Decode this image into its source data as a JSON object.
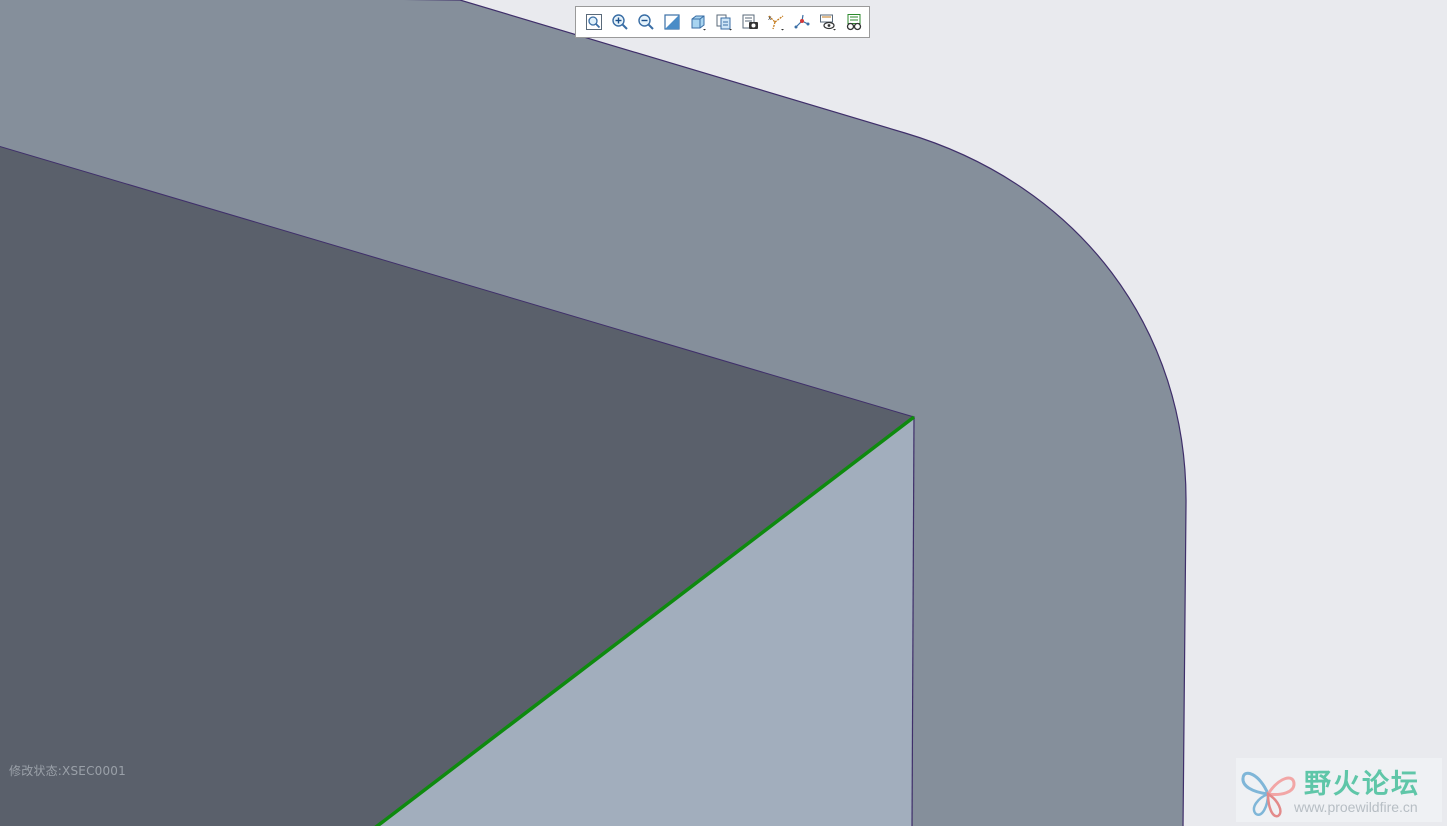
{
  "toolbar": {
    "items": [
      {
        "icon": "refit-icon"
      },
      {
        "icon": "zoom-in-icon"
      },
      {
        "icon": "zoom-out-icon"
      },
      {
        "icon": "repaint-icon"
      },
      {
        "icon": "display-style-icon"
      },
      {
        "icon": "saved-views-icon"
      },
      {
        "icon": "view-manager-icon"
      },
      {
        "icon": "datum-display-icon"
      },
      {
        "icon": "annotation-display-icon"
      },
      {
        "icon": "spin-center-icon"
      },
      {
        "icon": "appearance-icon"
      }
    ]
  },
  "state_label": "修改状态:XSEC0001",
  "watermark": {
    "title": "野火论坛",
    "url": "www.proewildfire.cn"
  },
  "colors": {
    "background": "#e9eaee",
    "top_face": "#858f9b",
    "dark_face": "#5a606b",
    "light_face": "#a2aebd",
    "edge": "#3f2f6a",
    "highlight_edge": "#0e8a0e",
    "watermark_text": "#5fc6a8"
  }
}
